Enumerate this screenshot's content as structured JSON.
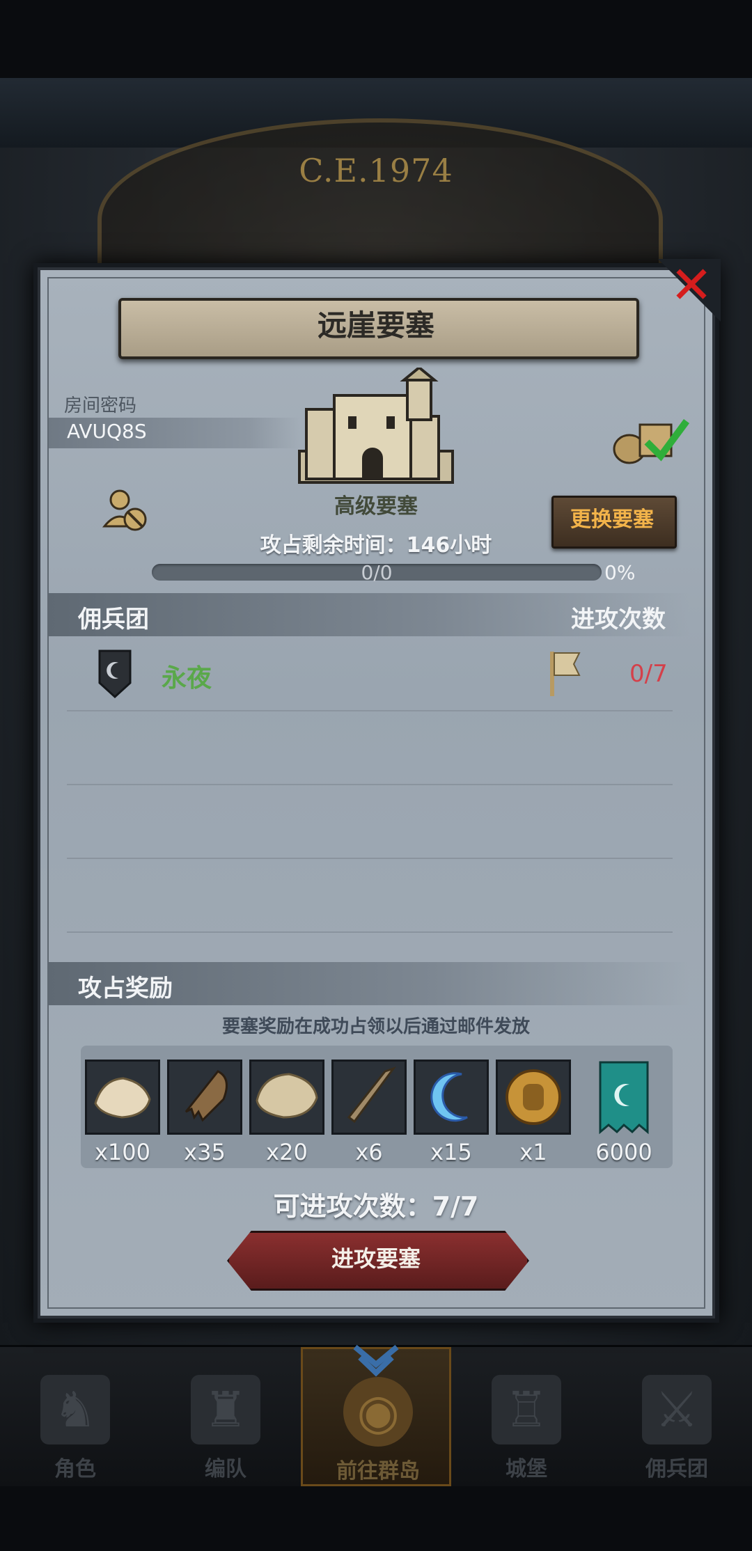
{
  "header": {
    "era": "C.E.1974"
  },
  "dialog": {
    "title": "远崖要塞",
    "room": {
      "label": "房间密码",
      "code": "AVUQ8S"
    },
    "fortress": {
      "level": "高级要塞",
      "remaining_time": "攻占剩余时间：146小时",
      "change_button": "更换要塞"
    },
    "progress": {
      "count": "0/0",
      "percent_text": "0%",
      "fraction": 0
    },
    "columns": {
      "guild": "佣兵团",
      "attacks": "进攻次数"
    },
    "guilds": [
      {
        "name": "永夜",
        "attacks": "0/7"
      }
    ],
    "rewards": {
      "title": "攻占奖励",
      "note": "要塞奖励在成功占领以后通过邮件发放",
      "items": [
        {
          "icon": "wool-pelt-icon",
          "qty": "x100"
        },
        {
          "icon": "beast-claw-icon",
          "qty": "x35"
        },
        {
          "icon": "fur-hide-icon",
          "qty": "x20"
        },
        {
          "icon": "horn-icon",
          "qty": "x6"
        },
        {
          "icon": "crescent-moon-icon",
          "qty": "x15"
        },
        {
          "icon": "knight-medal-icon",
          "qty": "x1"
        },
        {
          "icon": "guild-banner-icon",
          "qty": "6000"
        }
      ]
    },
    "attempts": "可进攻次数：7/7",
    "attack_button": "进攻要塞"
  },
  "nav": {
    "items": [
      {
        "label": "角色",
        "icon": "knight-helmet-icon"
      },
      {
        "label": "编队",
        "icon": "team-icon"
      },
      {
        "label": "前往群岛",
        "icon": "globe-icon"
      },
      {
        "label": "城堡",
        "icon": "castle-icon"
      },
      {
        "label": "佣兵团",
        "icon": "mercenary-icon"
      }
    ],
    "active": "前往群岛"
  },
  "colors": {
    "accent_gold": "#f2b34a",
    "guild_green": "#5aa84a",
    "count_red": "#d4404a",
    "close_red": "#d51d1d"
  }
}
